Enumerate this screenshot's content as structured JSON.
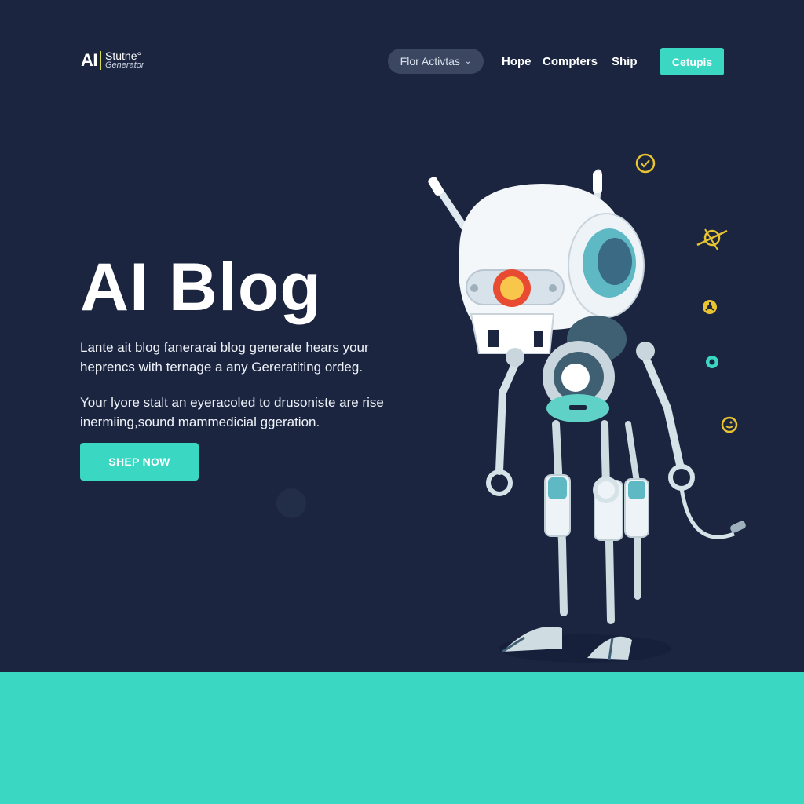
{
  "header": {
    "logo_mark": "AI",
    "logo_name": "Stutne°",
    "logo_sub": "Generator",
    "dropdown_label": "Flor Activtas",
    "nav_links": [
      "Hope",
      "Compters",
      "Ship"
    ],
    "cta_label": "Cetupis"
  },
  "hero": {
    "title": "AI Blog",
    "paragraph1": "Lante ait blog fanerarai blog generate hears your heprencs with ternage a any Gereratiting ordeg.",
    "paragraph2": "Your lyore stalt an eyeracoled to drusoniste are rise inermiing,sound mammedicial ggeration.",
    "cta_label": "SHEP NOW"
  },
  "colors": {
    "background": "#1b2540",
    "accent": "#3ad8c2",
    "dropdown_bg": "#3b4761",
    "icon_yellow": "#e8c431",
    "robot_eye": "#f7c64a"
  },
  "icons": [
    "check-circle-icon",
    "target-crosshair-icon",
    "small-gear-icon",
    "ring-icon",
    "smiley-icon",
    "chevron-down-icon"
  ]
}
